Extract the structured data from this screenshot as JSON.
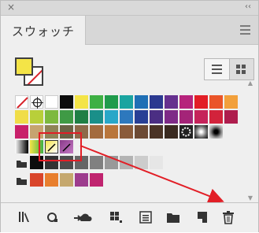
{
  "panel": {
    "title": "スウォッチ",
    "close_glyph": "×",
    "collapse_glyph": "‹‹"
  },
  "colors": {
    "fill": "#f4e447",
    "accent_red": "#e21e26",
    "panel_bg": "#efefef"
  },
  "swatches": {
    "row1": [
      "none",
      "registration",
      "white",
      "black",
      "yellow",
      "green",
      "green",
      "teal",
      "blue",
      "navy",
      "purple",
      "magenta",
      "red",
      "red",
      "orange",
      "orange"
    ],
    "row2": [
      "yellow",
      "lime",
      "green",
      "green",
      "green",
      "teal",
      "cyan",
      "blue",
      "navy",
      "purple",
      "violet",
      "magenta",
      "red",
      "red",
      "rose",
      "rose"
    ],
    "row3": [
      "pink",
      "tan",
      "olive",
      "brown",
      "brown",
      "brown",
      "brown",
      "dark",
      "dark",
      "darkbrown",
      "pattern",
      "gradient",
      "black-radial"
    ]
  },
  "toolbar_icons": [
    "library-icon",
    "place-icon",
    "cloud-icon",
    "new-group-icon",
    "options-icon",
    "folder-icon",
    "new-swatch-icon",
    "delete-icon"
  ]
}
